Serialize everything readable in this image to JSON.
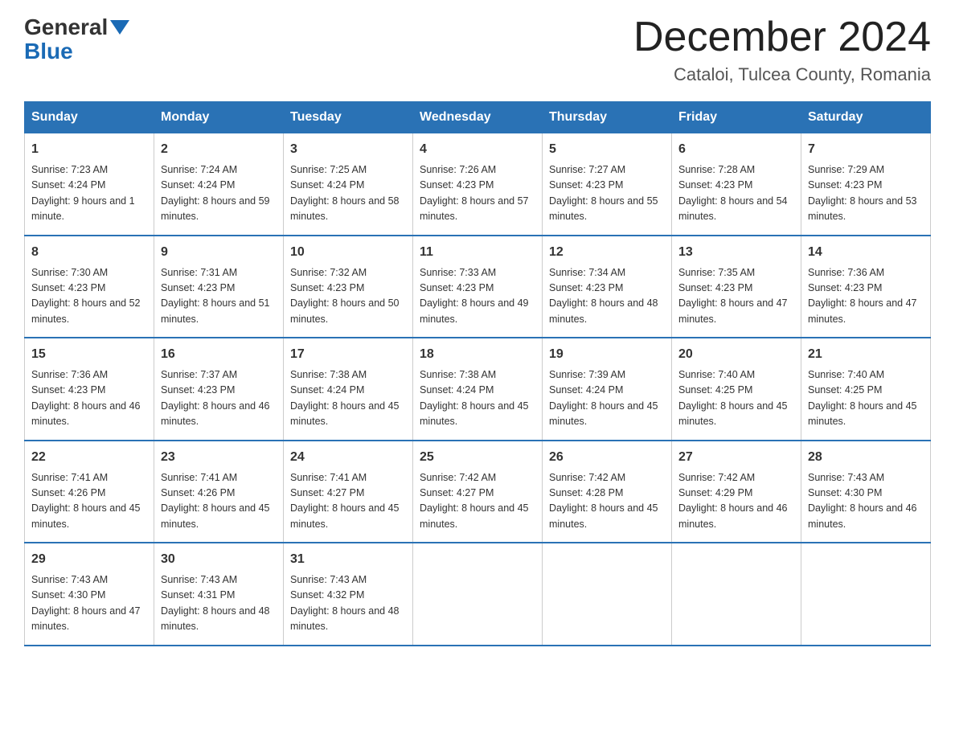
{
  "header": {
    "logo_general": "General",
    "logo_blue": "Blue",
    "month_title": "December 2024",
    "location": "Cataloi, Tulcea County, Romania"
  },
  "days_of_week": [
    "Sunday",
    "Monday",
    "Tuesday",
    "Wednesday",
    "Thursday",
    "Friday",
    "Saturday"
  ],
  "weeks": [
    [
      {
        "day": "1",
        "sunrise": "7:23 AM",
        "sunset": "4:24 PM",
        "daylight": "9 hours and 1 minute."
      },
      {
        "day": "2",
        "sunrise": "7:24 AM",
        "sunset": "4:24 PM",
        "daylight": "8 hours and 59 minutes."
      },
      {
        "day": "3",
        "sunrise": "7:25 AM",
        "sunset": "4:24 PM",
        "daylight": "8 hours and 58 minutes."
      },
      {
        "day": "4",
        "sunrise": "7:26 AM",
        "sunset": "4:23 PM",
        "daylight": "8 hours and 57 minutes."
      },
      {
        "day": "5",
        "sunrise": "7:27 AM",
        "sunset": "4:23 PM",
        "daylight": "8 hours and 55 minutes."
      },
      {
        "day": "6",
        "sunrise": "7:28 AM",
        "sunset": "4:23 PM",
        "daylight": "8 hours and 54 minutes."
      },
      {
        "day": "7",
        "sunrise": "7:29 AM",
        "sunset": "4:23 PM",
        "daylight": "8 hours and 53 minutes."
      }
    ],
    [
      {
        "day": "8",
        "sunrise": "7:30 AM",
        "sunset": "4:23 PM",
        "daylight": "8 hours and 52 minutes."
      },
      {
        "day": "9",
        "sunrise": "7:31 AM",
        "sunset": "4:23 PM",
        "daylight": "8 hours and 51 minutes."
      },
      {
        "day": "10",
        "sunrise": "7:32 AM",
        "sunset": "4:23 PM",
        "daylight": "8 hours and 50 minutes."
      },
      {
        "day": "11",
        "sunrise": "7:33 AM",
        "sunset": "4:23 PM",
        "daylight": "8 hours and 49 minutes."
      },
      {
        "day": "12",
        "sunrise": "7:34 AM",
        "sunset": "4:23 PM",
        "daylight": "8 hours and 48 minutes."
      },
      {
        "day": "13",
        "sunrise": "7:35 AM",
        "sunset": "4:23 PM",
        "daylight": "8 hours and 47 minutes."
      },
      {
        "day": "14",
        "sunrise": "7:36 AM",
        "sunset": "4:23 PM",
        "daylight": "8 hours and 47 minutes."
      }
    ],
    [
      {
        "day": "15",
        "sunrise": "7:36 AM",
        "sunset": "4:23 PM",
        "daylight": "8 hours and 46 minutes."
      },
      {
        "day": "16",
        "sunrise": "7:37 AM",
        "sunset": "4:23 PM",
        "daylight": "8 hours and 46 minutes."
      },
      {
        "day": "17",
        "sunrise": "7:38 AM",
        "sunset": "4:24 PM",
        "daylight": "8 hours and 45 minutes."
      },
      {
        "day": "18",
        "sunrise": "7:38 AM",
        "sunset": "4:24 PM",
        "daylight": "8 hours and 45 minutes."
      },
      {
        "day": "19",
        "sunrise": "7:39 AM",
        "sunset": "4:24 PM",
        "daylight": "8 hours and 45 minutes."
      },
      {
        "day": "20",
        "sunrise": "7:40 AM",
        "sunset": "4:25 PM",
        "daylight": "8 hours and 45 minutes."
      },
      {
        "day": "21",
        "sunrise": "7:40 AM",
        "sunset": "4:25 PM",
        "daylight": "8 hours and 45 minutes."
      }
    ],
    [
      {
        "day": "22",
        "sunrise": "7:41 AM",
        "sunset": "4:26 PM",
        "daylight": "8 hours and 45 minutes."
      },
      {
        "day": "23",
        "sunrise": "7:41 AM",
        "sunset": "4:26 PM",
        "daylight": "8 hours and 45 minutes."
      },
      {
        "day": "24",
        "sunrise": "7:41 AM",
        "sunset": "4:27 PM",
        "daylight": "8 hours and 45 minutes."
      },
      {
        "day": "25",
        "sunrise": "7:42 AM",
        "sunset": "4:27 PM",
        "daylight": "8 hours and 45 minutes."
      },
      {
        "day": "26",
        "sunrise": "7:42 AM",
        "sunset": "4:28 PM",
        "daylight": "8 hours and 45 minutes."
      },
      {
        "day": "27",
        "sunrise": "7:42 AM",
        "sunset": "4:29 PM",
        "daylight": "8 hours and 46 minutes."
      },
      {
        "day": "28",
        "sunrise": "7:43 AM",
        "sunset": "4:30 PM",
        "daylight": "8 hours and 46 minutes."
      }
    ],
    [
      {
        "day": "29",
        "sunrise": "7:43 AM",
        "sunset": "4:30 PM",
        "daylight": "8 hours and 47 minutes."
      },
      {
        "day": "30",
        "sunrise": "7:43 AM",
        "sunset": "4:31 PM",
        "daylight": "8 hours and 48 minutes."
      },
      {
        "day": "31",
        "sunrise": "7:43 AM",
        "sunset": "4:32 PM",
        "daylight": "8 hours and 48 minutes."
      },
      null,
      null,
      null,
      null
    ]
  ]
}
